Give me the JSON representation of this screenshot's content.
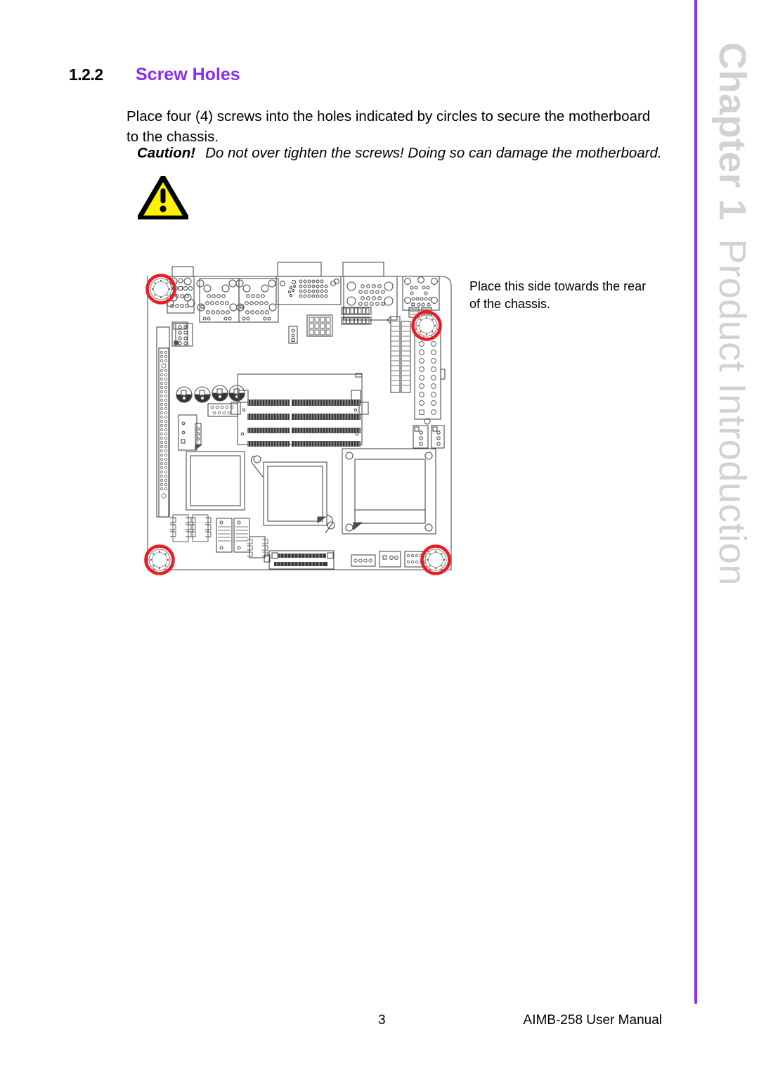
{
  "page": {
    "accent_color": "#8c2bf5",
    "chapter_tab_color": "#d2d2d2"
  },
  "chapter_tab": {
    "number_label": "Chapter 1",
    "title_label": "Product Introduction"
  },
  "heading": {
    "number": "1.2.2",
    "title": "Screw Holes"
  },
  "body": {
    "paragraph": "Place four (4) screws into the holes indicated by circles to secure the motherboard to the chassis."
  },
  "caution": {
    "label": "Caution!",
    "text": "Do not over tighten the screws! Doing so can damage the motherboard.",
    "icon_name": "warning-triangle-icon",
    "icon_fill": "#fff200",
    "icon_stroke": "#000000"
  },
  "figure": {
    "side_note": "Place this side towards the rear of the chassis.",
    "screw_hole_marker_color": "#ee1b22",
    "screw_hole_count": 4,
    "board_outline_color": "#4d4d4d"
  },
  "footer": {
    "page_number": "3",
    "manual_title": "AIMB-258 User Manual"
  }
}
